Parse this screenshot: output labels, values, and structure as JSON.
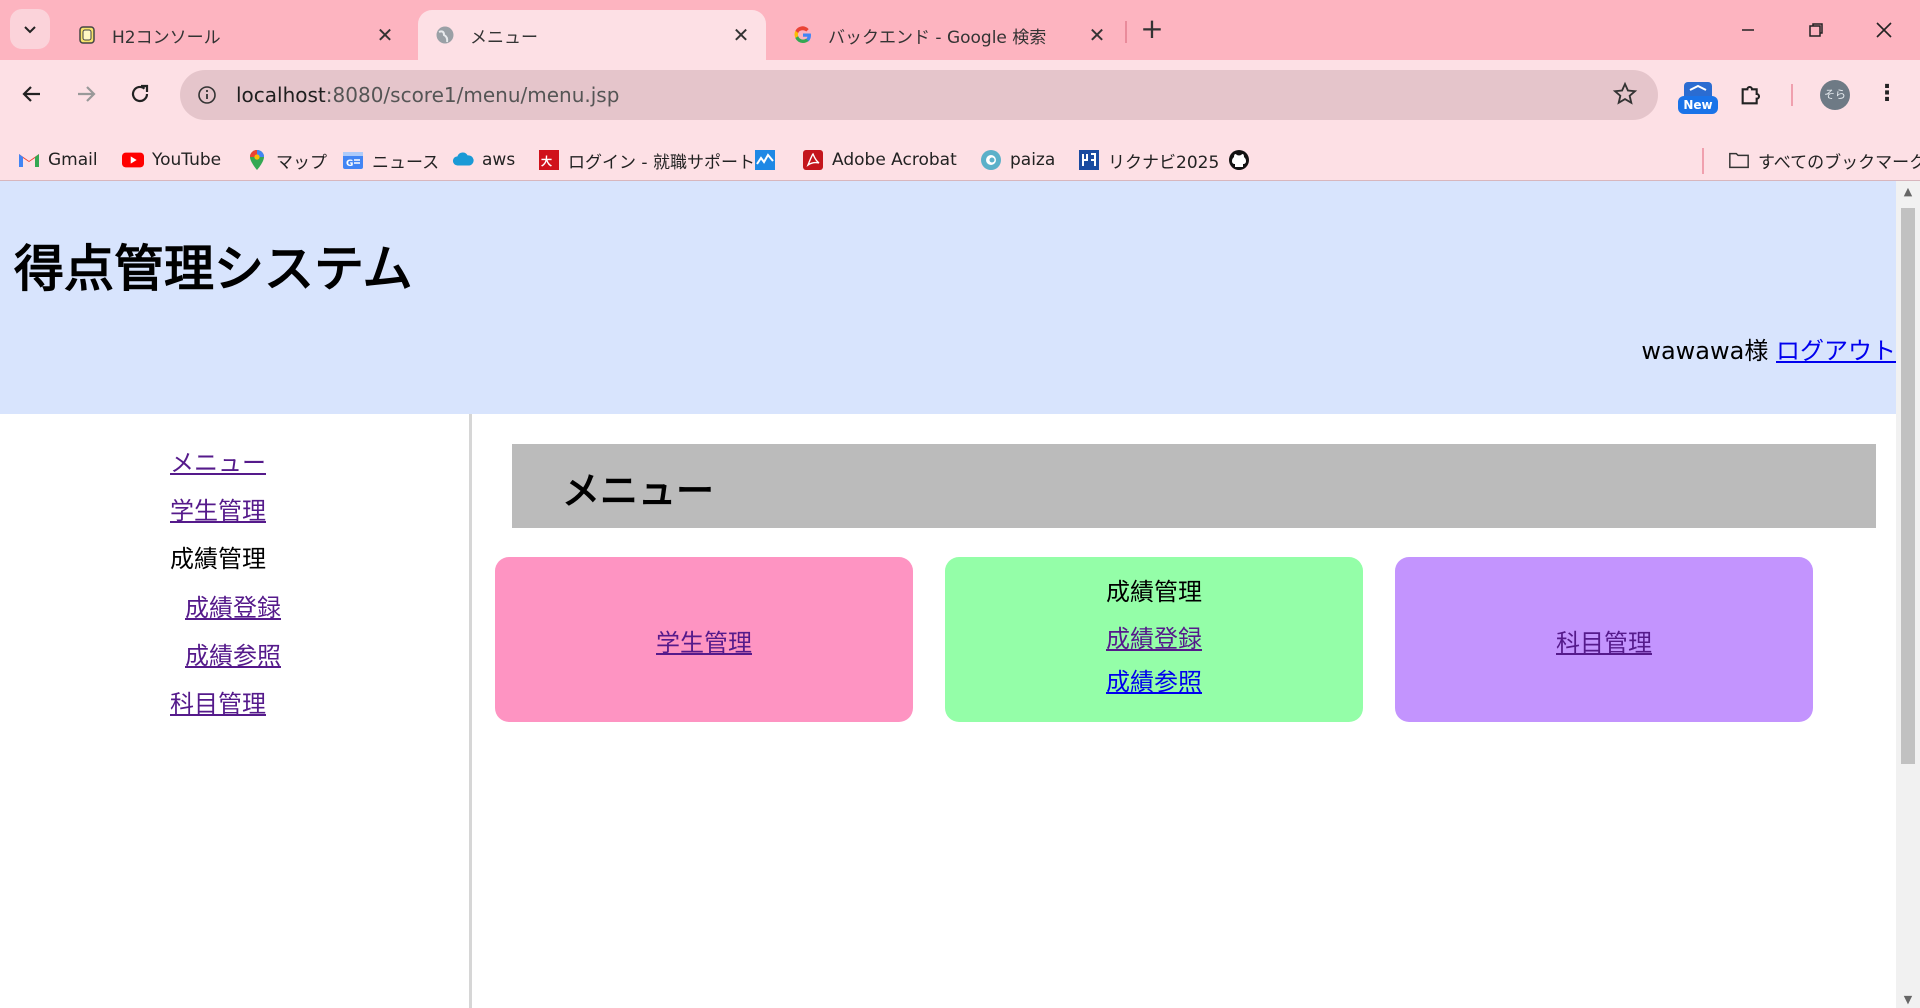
{
  "browser": {
    "tabs": [
      {
        "title": "H2コンソール",
        "icon": "database-icon"
      },
      {
        "title": "メニュー",
        "icon": "globe-icon"
      },
      {
        "title": "バックエンド - Google 検索",
        "icon": "google-icon"
      }
    ],
    "address": {
      "host": "localhost",
      "rest": ":8080/score1/menu/menu.jsp"
    },
    "new_badge": "New",
    "profile_initials": "そら",
    "bookmarks": [
      {
        "label": "Gmail",
        "icon": "gmail-icon"
      },
      {
        "label": "YouTube",
        "icon": "youtube-icon"
      },
      {
        "label": "マップ",
        "icon": "maps-icon"
      },
      {
        "label": "ニュース",
        "icon": "news-icon"
      },
      {
        "label": "aws",
        "icon": "aws-icon"
      },
      {
        "label": "ログイン - 就職サポート",
        "icon": "ohara-icon"
      },
      {
        "label": "",
        "icon": "chart-icon"
      },
      {
        "label": "Adobe Acrobat",
        "icon": "acrobat-icon"
      },
      {
        "label": "paiza",
        "icon": "paiza-icon"
      },
      {
        "label": "リクナビ2025",
        "icon": "rikunabi-icon"
      },
      {
        "label": "",
        "icon": "github-icon"
      }
    ],
    "all_bookmarks": "すべてのブックマーク"
  },
  "header": {
    "title": "得点管理システム",
    "user": "wawawa様",
    "logout": "ログアウト"
  },
  "sidebar": {
    "menu": "メニュー",
    "student": "学生管理",
    "grades": "成績管理",
    "grade_register": "成績登録",
    "grade_reference": "成績参照",
    "subject": "科目管理"
  },
  "main": {
    "heading": "メニュー",
    "cards": {
      "student": "学生管理",
      "grades_title": "成績管理",
      "grade_register": "成績登録",
      "grade_reference": "成績参照",
      "subject": "科目管理"
    }
  },
  "colors": {
    "header_bg": "#d8e4fd",
    "card_student": "#fe94c2",
    "card_grades": "#94fea8",
    "card_subject": "#c394fe",
    "heading_bg": "#bbbbbb",
    "tab_strip": "#fdb4c0"
  }
}
